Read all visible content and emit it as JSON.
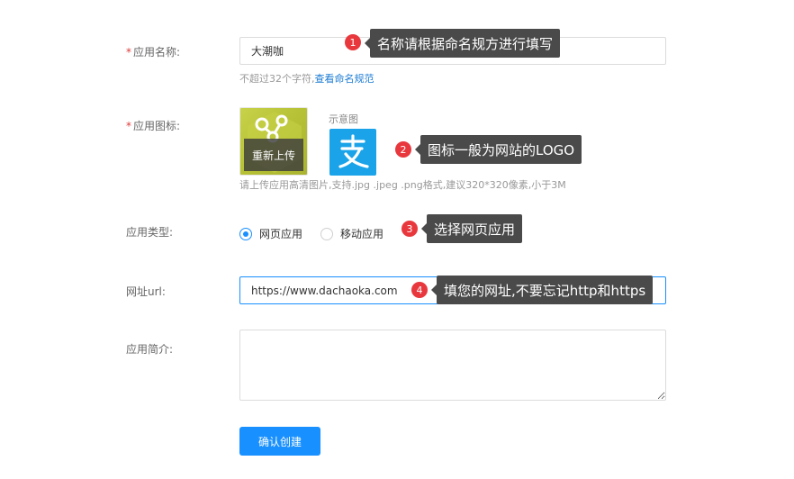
{
  "form": {
    "name": {
      "label": "应用名称:",
      "required": "*",
      "value": "大潮咖",
      "help_text": "不超过32个字符,",
      "help_link": "查看命名规范"
    },
    "icon": {
      "label": "应用图标:",
      "required": "*",
      "reupload_label": "重新上传",
      "sample_label": "示意图",
      "sample_icon": "alipay-icon",
      "help_text": "请上传应用高清图片,支持.jpg .jpeg .png格式,建议320*320像素,小于3M"
    },
    "type": {
      "label": "应用类型:",
      "options": [
        {
          "label": "网页应用",
          "checked": true
        },
        {
          "label": "移动应用",
          "checked": false
        }
      ]
    },
    "url": {
      "label": "网址url:",
      "value": "https://www.dachaoka.com"
    },
    "intro": {
      "label": "应用简介:",
      "value": ""
    },
    "submit_label": "确认创建"
  },
  "annotations": [
    {
      "number": "1",
      "text": "名称请根据命名规方进行填写"
    },
    {
      "number": "2",
      "text": "图标一般为网站的LOGO"
    },
    {
      "number": "3",
      "text": "选择网页应用"
    },
    {
      "number": "4",
      "text": "填您的网址,不要忘记http和https"
    }
  ],
  "colors": {
    "primary": "#1890ff",
    "required": "#e03b3b",
    "link": "#1b7bd3",
    "badge": "#e8383d",
    "tooltip": "#4a4a4a",
    "alipay": "#1aa3e8"
  }
}
